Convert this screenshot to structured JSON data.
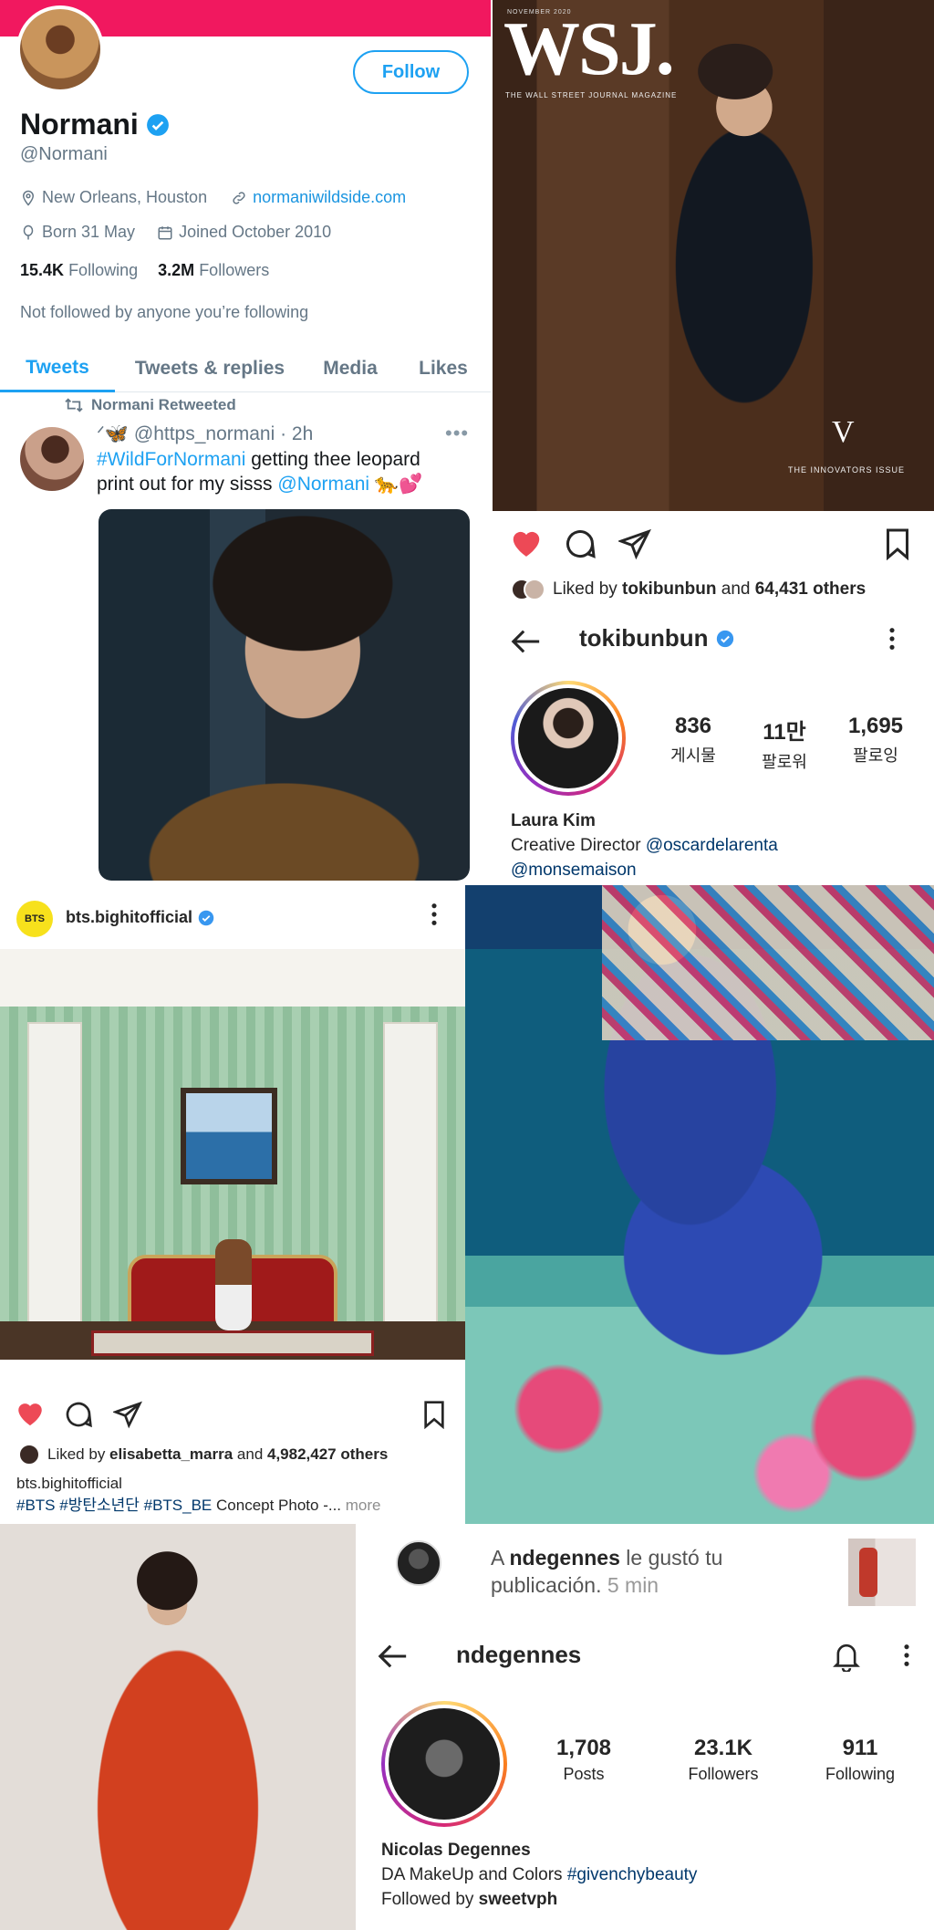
{
  "twitter": {
    "name": "Normani",
    "handle": "@Normani",
    "follow_label": "Follow",
    "location": "New Orleans, Houston",
    "website": "normaniwildside.com",
    "born": "Born 31 May",
    "joined": "Joined October 2010",
    "following_count": "15.4K",
    "following_label": "Following",
    "followers_count": "3.2M",
    "followers_label": "Followers",
    "not_followed": "Not followed by anyone you’re following",
    "tabs": [
      "Tweets",
      "Tweets & replies",
      "Media",
      "Likes"
    ],
    "retweet_label": "Normani Retweeted",
    "tweet_user": "ᐟ🦋 @https_normani · 2h",
    "tweet_hashtag": "#WildForNormani",
    "tweet_text_1": " getting thee leopard print out for my sisss ",
    "tweet_mention": "@Normani",
    "tweet_emoji": " 🐆💕"
  },
  "wsj": {
    "logo": "WSJ.",
    "date": "NOVEMBER 2020",
    "subtitle": "THE WALL STREET JOURNAL MAGAZINE",
    "v": "V",
    "issue": "THE INNOVATORS ISSUE"
  },
  "toki_post": {
    "liked_by_prefix": "Liked by ",
    "liked_by_user": "tokibunbun",
    "liked_by_mid": " and ",
    "liked_by_others": "64,431 others"
  },
  "toki_profile": {
    "username": "tokibunbun",
    "posts": "836",
    "posts_label": "게시물",
    "followers": "11만",
    "followers_label": "팔로워",
    "following": "1,695",
    "following_label": "팔로잉",
    "name": "Laura Kim",
    "bio_text": "Creative Director ",
    "bio_mention_1": "@oscardelarenta",
    "bio_mention_2": "@monsemaison"
  },
  "bts_post": {
    "avatar_text": "BTS",
    "username": "bts.bighitofficial",
    "liked_by_prefix": "Liked by ",
    "liked_by_user": "elisabetta_marra",
    "liked_by_mid": " and ",
    "liked_by_others": "4,982,427 others",
    "caption_user": "bts.bighitofficial",
    "caption_tags": "#BTS #방탄소년단 #BTS_BE",
    "caption_text": " Concept Photo -...",
    "caption_more": " more"
  },
  "ndegennes": {
    "notif_prefix": "A ",
    "notif_user": "ndegennes",
    "notif_text": " le gustó tu",
    "notif_text_2": "publicación.",
    "notif_time": " 5 min",
    "username": "ndegennes",
    "posts": "1,708",
    "posts_label": "Posts",
    "followers": "23.1K",
    "followers_label": "Followers",
    "following": "911",
    "following_label": "Following",
    "name": "Nicolas Degennes",
    "bio_text": "DA MakeUp and Colors ",
    "bio_tag": "#givenchybeauty",
    "followed_by_prefix": "Followed by ",
    "followed_by_user": "sweetvph"
  },
  "colors": {
    "twitter_blue": "#1da1f2",
    "banner_pink": "#f1185f",
    "like_red": "#ed4956",
    "verified_blue": "#3897f0"
  }
}
